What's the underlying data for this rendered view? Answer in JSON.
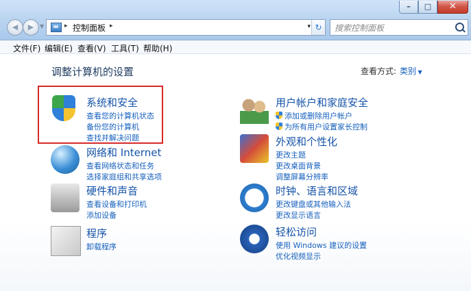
{
  "window": {
    "minimize": "–",
    "maximize": "□",
    "close": "✕"
  },
  "nav": {
    "back_icon": "arrow-left-icon",
    "forward_icon": "arrow-right-icon"
  },
  "address": {
    "arrow": "▸",
    "path": "控制面板",
    "dropdown": "▾",
    "refresh": "↻"
  },
  "search": {
    "placeholder": "搜索控制面板"
  },
  "menu": [
    "文件(F)",
    "编辑(E)",
    "查看(V)",
    "工具(T)",
    "帮助(H)"
  ],
  "page": {
    "title": "调整计算机的设置",
    "view_label": "查看方式:",
    "view_value": "类别"
  },
  "categories": {
    "system": {
      "title": "系统和安全",
      "links": [
        "查看您的计算机状态",
        "备份您的计算机",
        "查找并解决问题"
      ],
      "icon": "security-shield-icon"
    },
    "network": {
      "title": "网络和 Internet",
      "links": [
        "查看网络状态和任务",
        "选择家庭组和共享选项"
      ],
      "icon": "network-globe-icon"
    },
    "hardware": {
      "title": "硬件和声音",
      "links": [
        "查看设备和打印机",
        "添加设备"
      ],
      "icon": "printer-icon"
    },
    "programs": {
      "title": "程序",
      "links": [
        "卸载程序"
      ],
      "icon": "programs-box-icon"
    },
    "users": {
      "title": "用户帐户和家庭安全",
      "links": [
        "添加或删除用户帐户",
        "为所有用户设置家长控制"
      ],
      "icon": "users-icon"
    },
    "appearance": {
      "title": "外观和个性化",
      "links": [
        "更改主题",
        "更改桌面背景",
        "调整屏幕分辨率"
      ],
      "icon": "appearance-paint-icon"
    },
    "clock": {
      "title": "时钟、语言和区域",
      "links": [
        "更改键盘或其他输入法",
        "更改显示语言"
      ],
      "icon": "clock-globe-icon"
    },
    "ease": {
      "title": "轻松访问",
      "links": [
        "使用 Windows 建议的设置",
        "优化视频显示"
      ],
      "icon": "ease-of-access-icon"
    }
  },
  "colors": {
    "link": "#1560bd",
    "highlight": "#d62828"
  }
}
